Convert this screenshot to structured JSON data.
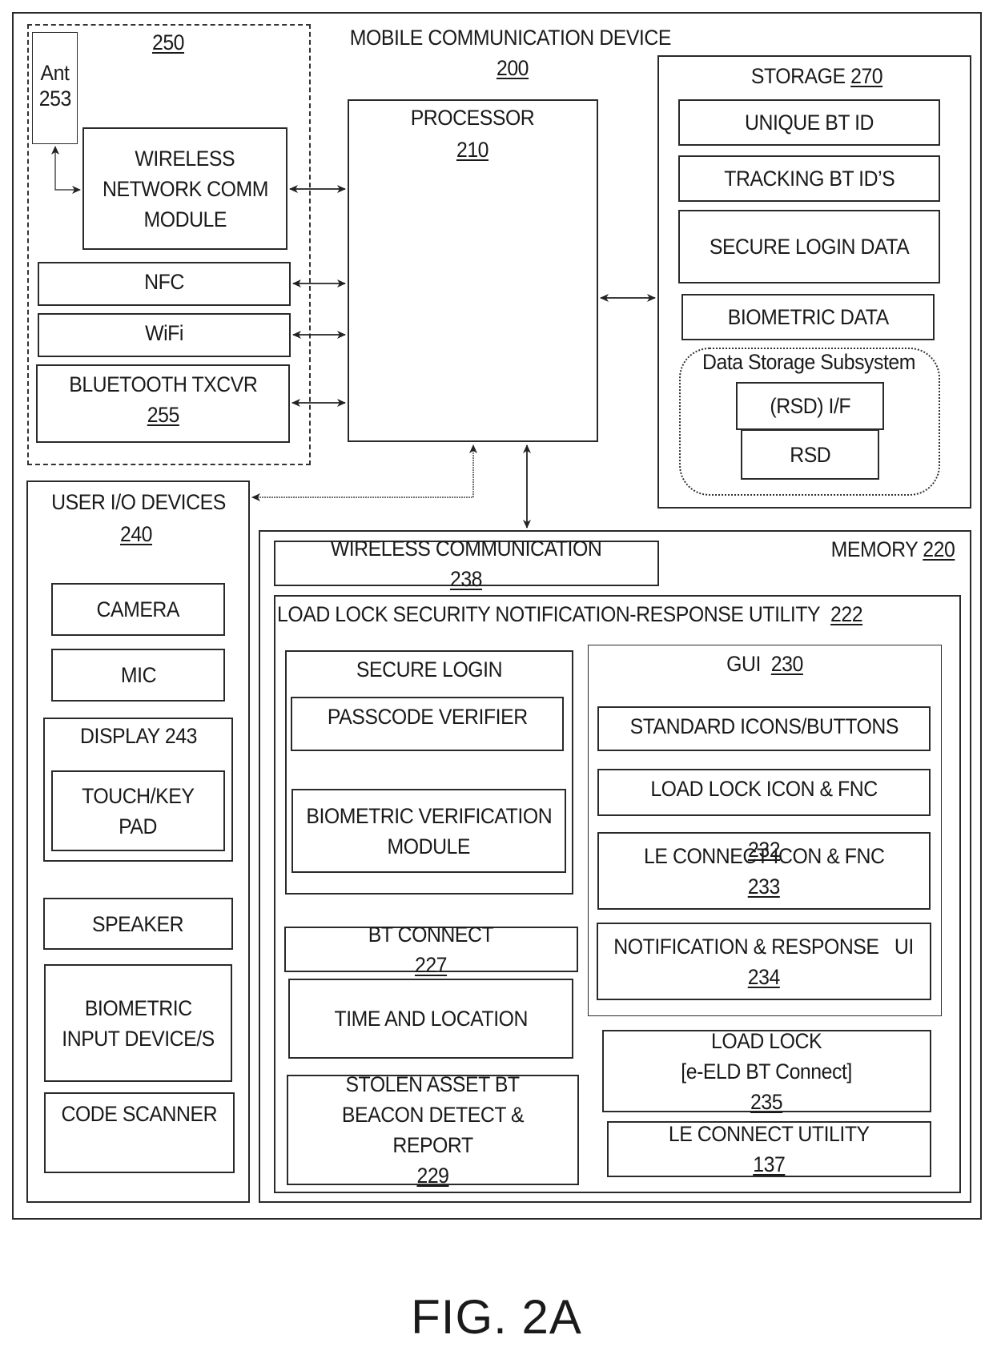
{
  "device": {
    "title": "MOBILE COMMUNICATION DEVICE",
    "ref": "200"
  },
  "wireless_group": {
    "ref": "250",
    "antenna": {
      "label": "Ant",
      "ref": "253"
    },
    "network_module": {
      "lines": [
        "WIRELESS",
        "NETWORK COMM",
        "MODULE"
      ]
    },
    "nfc": {
      "label": "NFC"
    },
    "wifi": {
      "label": "WiFi"
    },
    "bluetooth": {
      "label": "BLUETOOTH TXCVR",
      "ref": "255"
    }
  },
  "processor": {
    "label": "PROCESSOR",
    "ref": "210"
  },
  "storage": {
    "label": "STORAGE",
    "ref": "270",
    "items": [
      "UNIQUE BT ID",
      "TRACKING BT ID’S",
      "SECURE LOGIN DATA",
      "BIOMETRIC DATA"
    ],
    "subsystem": {
      "label": "Data Storage Subsystem",
      "interface": "(RSD) I/F",
      "device": "RSD"
    }
  },
  "user_io": {
    "label": "USER I/O DEVICES",
    "ref": "240",
    "camera": "CAMERA",
    "mic": "MIC",
    "display": {
      "label": "DISPLAY",
      "ref": "243",
      "touch_lines": [
        "TOUCH/KEY",
        "PAD"
      ]
    },
    "speaker": "SPEAKER",
    "biometric_lines": [
      "BIOMETRIC",
      "INPUT DEVICE/S"
    ],
    "code_scanner": "CODE SCANNER"
  },
  "memory": {
    "label": "MEMORY",
    "ref": "220",
    "wireless_comm": {
      "label": "WIRELESS COMMUNICATION",
      "ref": "238"
    },
    "utility": {
      "label": "LOAD LOCK SECURITY NOTIFICATION-RESPONSE UTILITY",
      "ref": "222",
      "secure_login": {
        "label": "SECURE LOGIN",
        "passcode": "PASSCODE VERIFIER",
        "biometric_lines": [
          "BIOMETRIC VERIFICATION",
          "MODULE"
        ]
      },
      "bt_connect": {
        "label": "BT CONNECT",
        "ref": "227"
      },
      "time_location": "TIME AND LOCATION",
      "stolen_asset": {
        "lines": [
          "STOLEN ASSET BT",
          "BEACON DETECT &",
          "REPORT"
        ],
        "ref": "229"
      },
      "gui": {
        "label": "GUI",
        "ref": "230",
        "standard": "STANDARD ICONS/BUTTONS",
        "load_lock_icon": {
          "label": "LOAD LOCK ICON & FNC",
          "ref": "232"
        },
        "le_connect_icon": {
          "label": "LE CONNECT ICON & FNC",
          "ref": "233"
        },
        "notification": {
          "label": "NOTIFICATION & RESPONSE   UI",
          "ref": "234"
        }
      },
      "load_lock": {
        "line1": "LOAD LOCK",
        "line2": "[e-ELD BT Connect]",
        "ref": "235"
      },
      "le_connect_utility": {
        "label": "LE CONNECT UTILITY",
        "ref": "137"
      }
    }
  },
  "figure_label": "FIG. 2A"
}
